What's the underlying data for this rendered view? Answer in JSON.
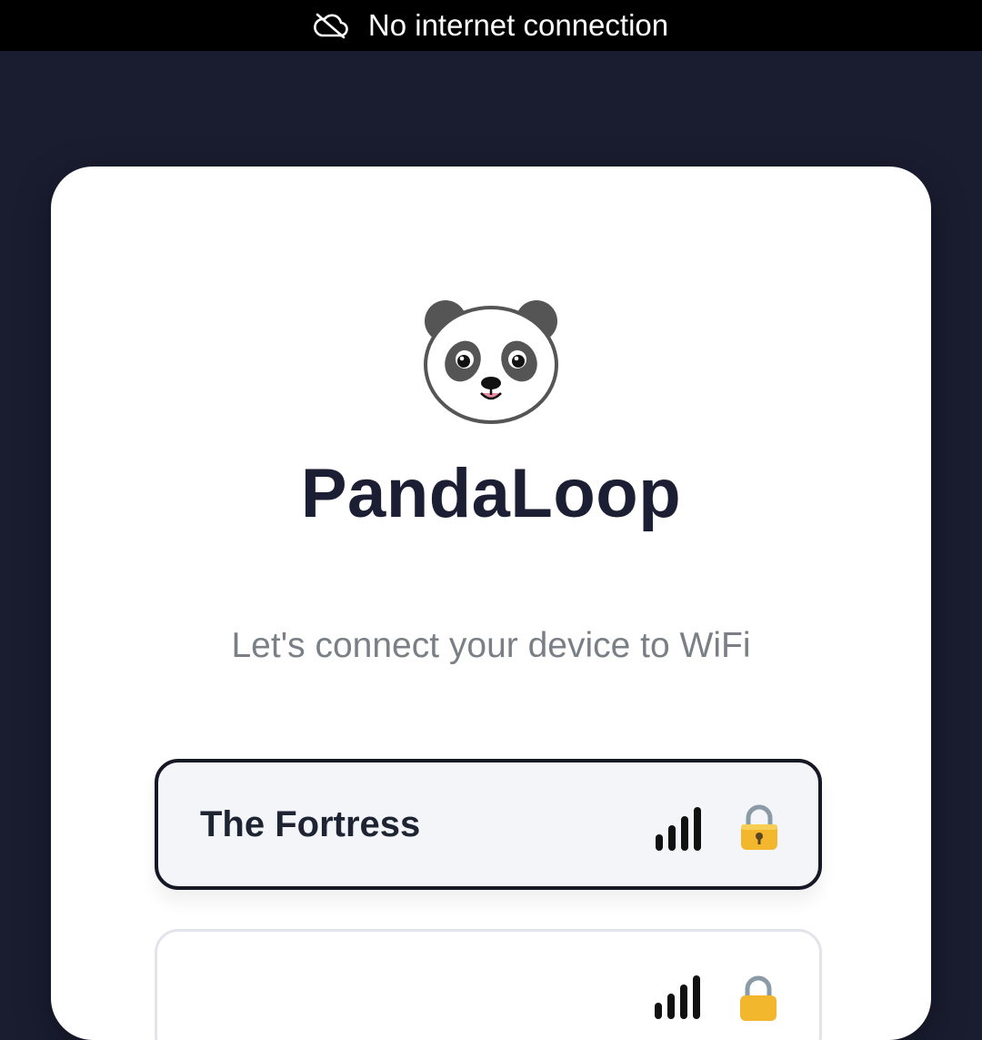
{
  "status_bar": {
    "message": "No internet connection",
    "icon": "cloud-off-icon"
  },
  "app": {
    "logo_icon": "panda-icon",
    "title": "PandaLoop",
    "subtitle": "Let's connect your device to WiFi"
  },
  "networks": [
    {
      "name": "The Fortress",
      "signal_bars": 4,
      "secured": true,
      "selected": true
    },
    {
      "name": "",
      "signal_bars": 4,
      "secured": true,
      "selected": false
    }
  ],
  "colors": {
    "background": "#1a1d30",
    "card": "#ffffff",
    "title": "#1c1e33",
    "subtitle": "#7a7f86",
    "selected_border": "#161826",
    "selected_fill": "#f3f5f8"
  }
}
